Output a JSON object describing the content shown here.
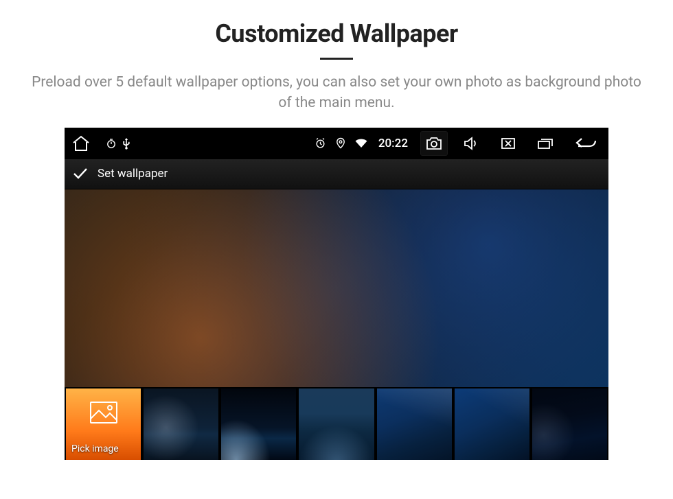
{
  "page": {
    "title": "Customized Wallpaper",
    "subtitle": "Preload over 5 default wallpaper options, you can also set your own photo as background photo of the main menu."
  },
  "statusbar": {
    "time": "20:22"
  },
  "header": {
    "title": "Set wallpaper"
  },
  "thumbs": {
    "pick_label": "Pick image"
  }
}
